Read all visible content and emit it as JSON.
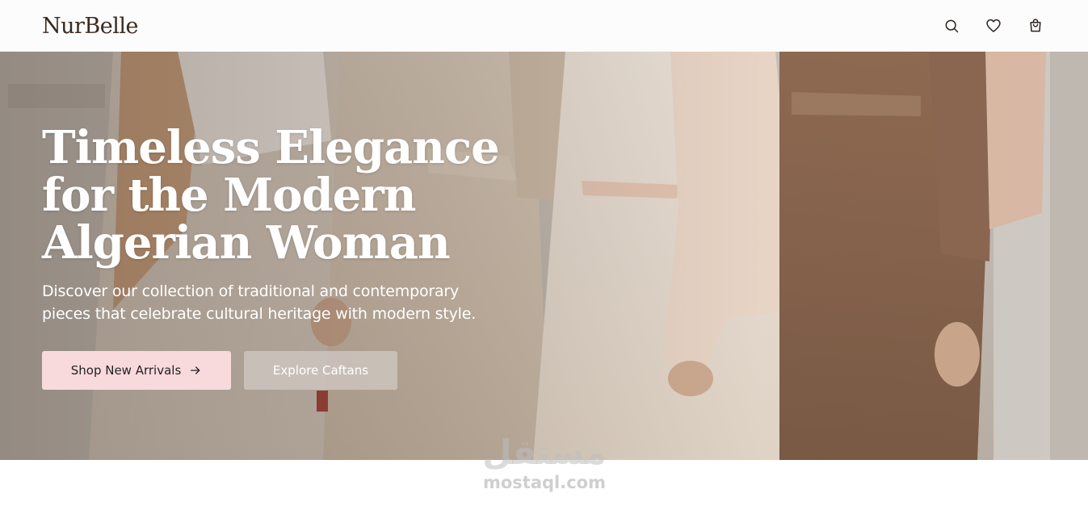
{
  "brand": {
    "logo": "NurBelle"
  },
  "header": {
    "icons": [
      "search-icon",
      "heart-icon",
      "shopping-bag-icon"
    ]
  },
  "hero": {
    "title_line1": "Timeless Elegance",
    "title_line2": "for the Modern",
    "title_line3": "Algerian Woman",
    "subtitle_line1": "Discover our collection of traditional and contemporary",
    "subtitle_line2": "pieces that celebrate cultural heritage with modern style.",
    "primary_button": "Shop New Arrivals",
    "secondary_button": "Explore Caftans"
  },
  "watermark": {
    "arabic": "مستقل",
    "latin": "mostaql.com"
  },
  "colors": {
    "primary_button_bg": "#f8dadd",
    "logo_text": "#3a2a22",
    "hero_text": "#ffffff"
  }
}
